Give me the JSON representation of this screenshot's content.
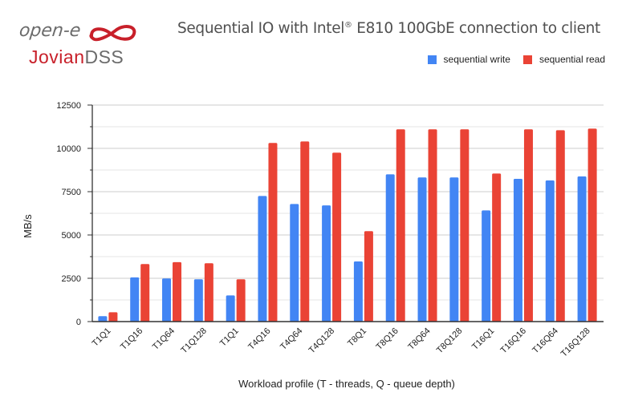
{
  "logo": {
    "brand_top": "open-e",
    "brand_bottom_part1": "Jovian",
    "brand_bottom_part2": "DSS",
    "logo_color_red": "#c8202a",
    "logo_color_gray": "#6b6b6b"
  },
  "chart_data": {
    "type": "bar",
    "title": "Sequential IO with Intel",
    "title_sup": "®",
    "title_rest": " E810 100GbE connection to client",
    "xlabel": "Workload profile (T - threads, Q - queue depth)",
    "ylabel": "MB/s",
    "ylim": [
      0,
      12500
    ],
    "yticks": [
      0,
      2500,
      5000,
      7500,
      10000,
      12500
    ],
    "grid": true,
    "legend_position": "top-right",
    "categories": [
      "T1Q1",
      "T1Q16",
      "T1Q64",
      "T1Q128",
      "T1Q1",
      "T4Q16",
      "T4Q64",
      "T4Q128",
      "T8Q1",
      "T8Q16",
      "T8Q64",
      "T8Q128",
      "T16Q1",
      "T16Q16",
      "T16Q64",
      "T16Q128"
    ],
    "series": [
      {
        "name": "sequential write",
        "color": "#4285f4",
        "values": [
          310,
          2550,
          2490,
          2440,
          1510,
          7250,
          6790,
          6710,
          3470,
          8500,
          8320,
          8320,
          6420,
          8240,
          8150,
          8380
        ]
      },
      {
        "name": "sequential read",
        "color": "#ea4335",
        "values": [
          540,
          3320,
          3430,
          3370,
          2440,
          10310,
          10400,
          9750,
          5220,
          11100,
          11100,
          11100,
          8550,
          11100,
          11050,
          11140
        ]
      }
    ]
  }
}
